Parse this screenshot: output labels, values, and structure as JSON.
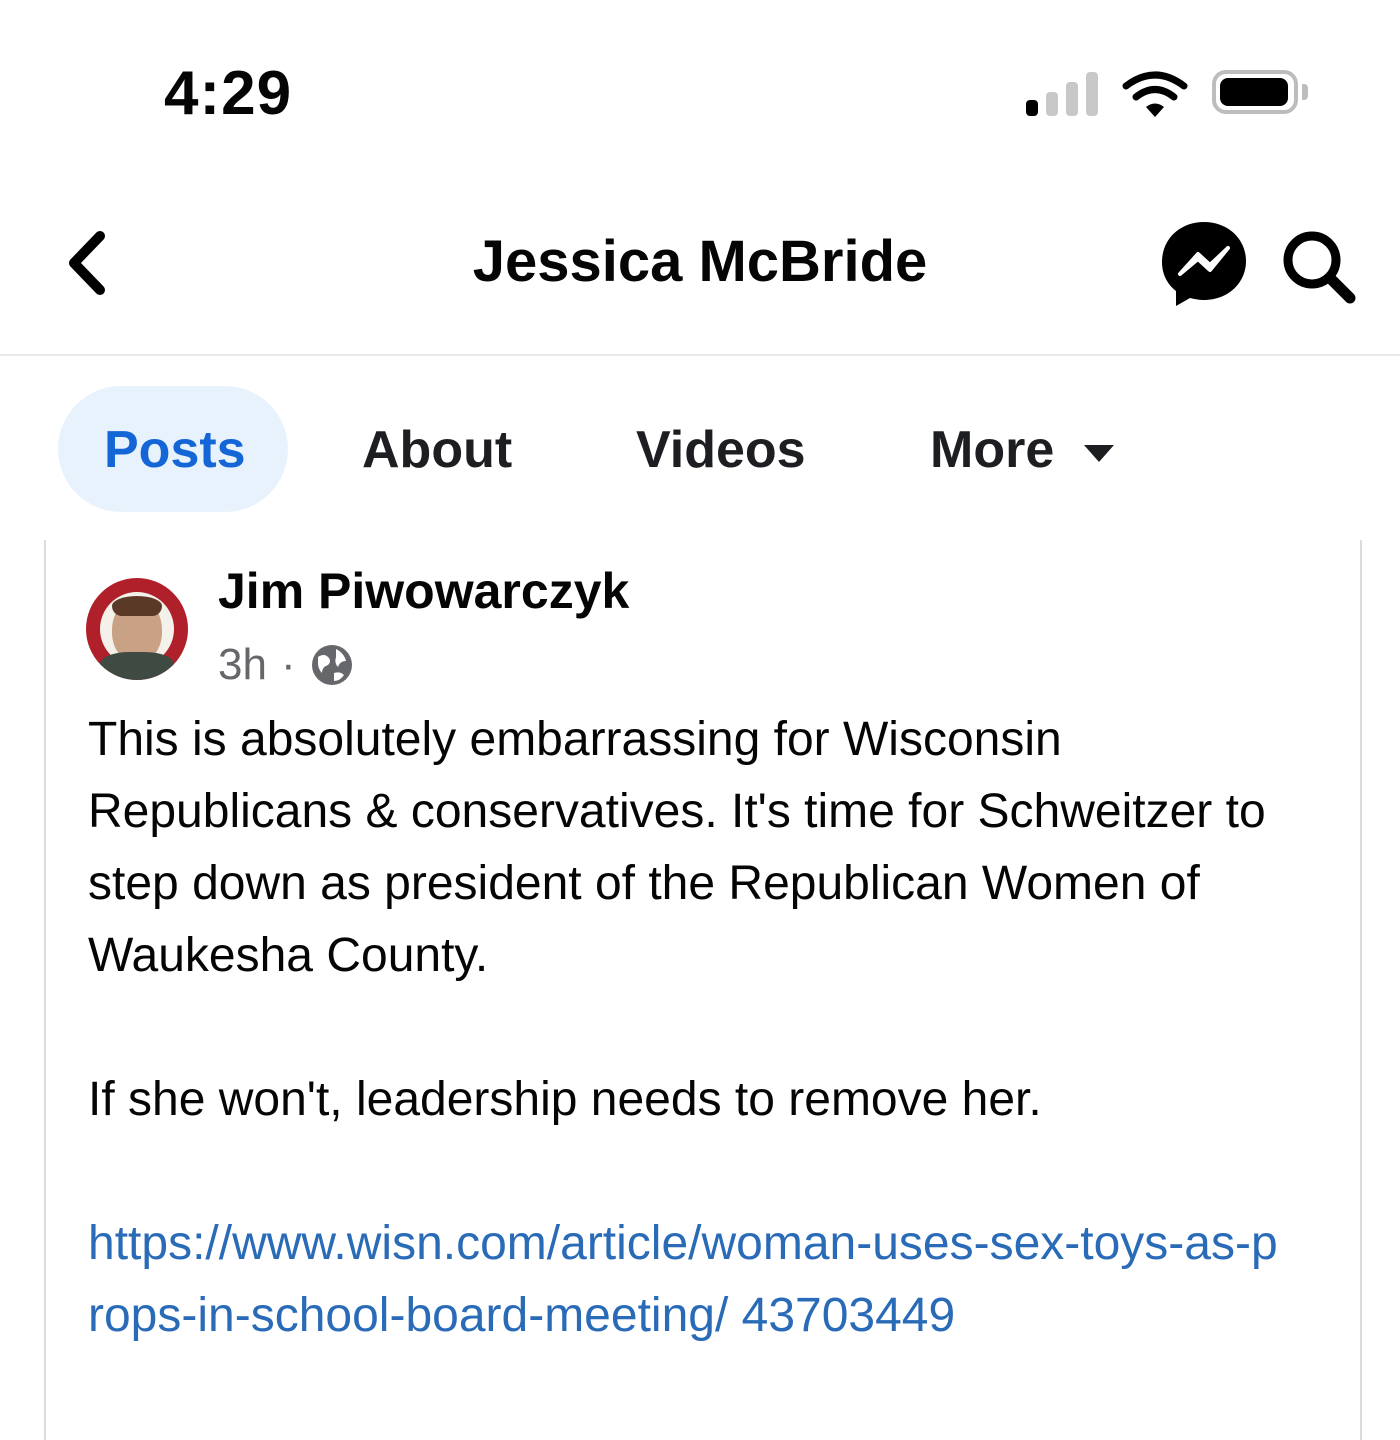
{
  "status_bar": {
    "time": "4:29"
  },
  "header": {
    "title": "Jessica McBride"
  },
  "tabs": [
    {
      "label": "Posts",
      "active": true
    },
    {
      "label": "About"
    },
    {
      "label": "Videos"
    },
    {
      "label": "More"
    }
  ],
  "post": {
    "author": "Jim Piwowarczyk",
    "time": "3h",
    "separator": "·",
    "paragraph_1": "This is absolutely embarrassing for Wisconsin Republicans & conservatives.  It's time for Schweitzer to step down as president of the Republican Women of Waukesha County.",
    "paragraph_2": "If she won't, leadership needs to remove her.",
    "link": "https://www.wisn.com/article/woman-uses-sex-toys-as-props-in-school-board-meeting/ 43703449"
  },
  "colors": {
    "accent": "#1466d6",
    "tab_pill": "#e8f2fd",
    "link": "#2a6bb8",
    "muted": "#65676b"
  }
}
